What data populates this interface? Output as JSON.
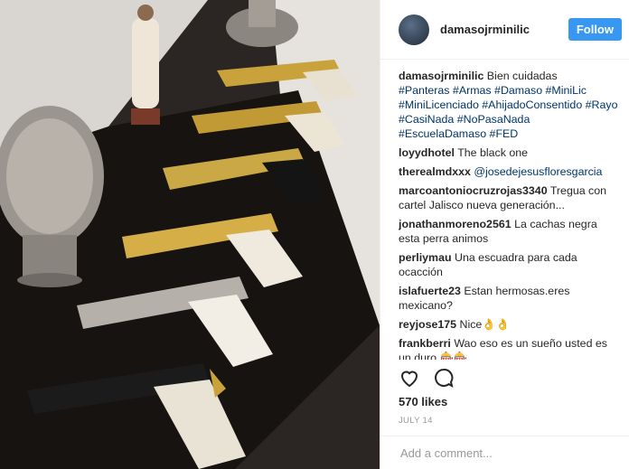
{
  "post": {
    "username": "damasojrminilic",
    "follow_label": "Follow",
    "caption_user": "damasojrminilic",
    "caption_text": "Bien cuidadas",
    "hashtags": "#Panteras #Armas #Damaso #MiniLic #MiniLicenciado #AhijadoConsentido #Rayo #CasiNada #NoPasaNada #EscuelaDamaso #FED",
    "comments": [
      {
        "user": "loyydhotel",
        "text": "The black one"
      },
      {
        "user": "therealmdxxx",
        "text": "@josedejesusfloresgarcia"
      },
      {
        "user": "marcoantoniocruzrojas3340",
        "text": "Tregua con cartel Jalisco nueva generación..."
      },
      {
        "user": "jonathanmoreno2561",
        "text": "La cachas negra esta perra animos"
      },
      {
        "user": "perliymau",
        "text": "Una escuadra para cada ocacción"
      },
      {
        "user": "islafuerte23",
        "text": "Estan hermosas.eres mexicano?"
      },
      {
        "user": "reyjose175",
        "text": "Nice👌👌"
      },
      {
        "user": "frankberri",
        "text": "Wao eso es un sueño usted es un duro 🎰🎰"
      }
    ],
    "likes": "570 likes",
    "date": "JULY 14",
    "add_comment_placeholder": "Add a comment...",
    "icons": {
      "like": "heart-icon",
      "comment": "comment-bubble-icon"
    }
  }
}
